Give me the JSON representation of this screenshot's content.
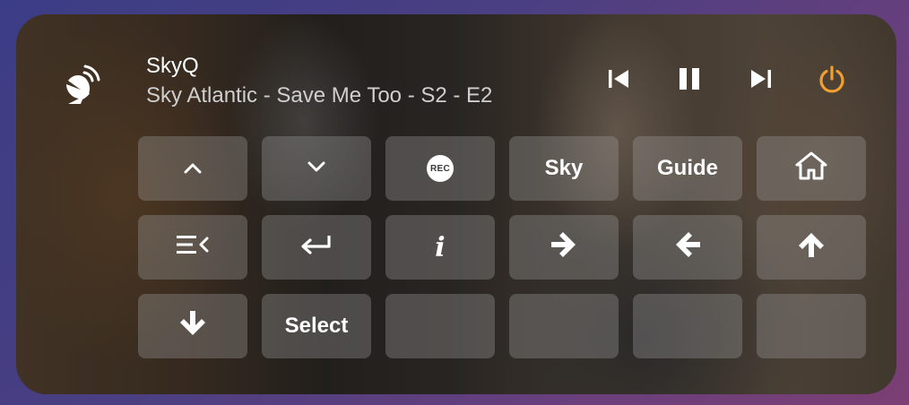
{
  "media": {
    "title": "SkyQ",
    "subtitle": "Sky Atlantic - Save Me Too - S2 - E2",
    "icon": "satellite-dish-icon",
    "controls": [
      "previous-track-icon",
      "pause-icon",
      "next-track-icon",
      "power-icon"
    ],
    "power_color": "#f0a030"
  },
  "keys": {
    "rec_label": "REC",
    "sky_label": "Sky",
    "guide_label": "Guide",
    "info_label": "i",
    "select_label": "Select"
  },
  "colors": {
    "text_primary": "#ffffff",
    "text_secondary": "#cfcfcf",
    "key_background": "rgba(160,160,160,0.34)"
  }
}
